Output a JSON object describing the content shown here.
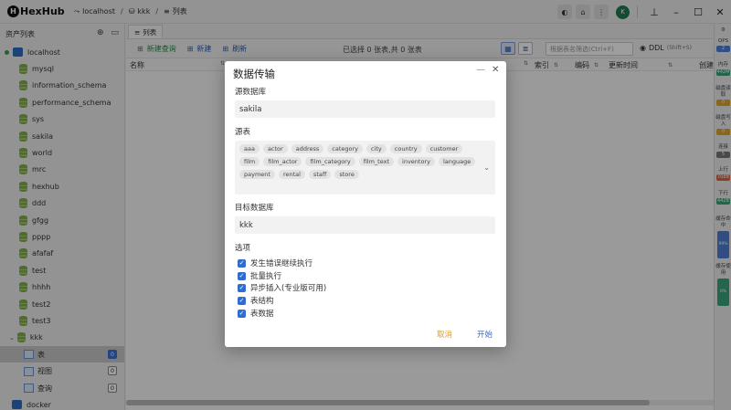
{
  "titlebar": {
    "app_name": "HexHub",
    "breadcrumbs": [
      {
        "icon": "connection-icon",
        "label": "localhost"
      },
      {
        "icon": "database-icon",
        "label": "kkk"
      },
      {
        "icon": "list-icon",
        "label": "列表"
      }
    ],
    "avatar_letter": "K"
  },
  "sidebar": {
    "title": "资产列表",
    "connection": "localhost",
    "databases": [
      "mysql",
      "information_schema",
      "performance_schema",
      "sys",
      "sakila",
      "world",
      "mrc",
      "hexhub",
      "ddd",
      "gfgg",
      "pppp",
      "afafaf",
      "test",
      "hhhh",
      "test2",
      "test3"
    ],
    "open_db": "kkk",
    "sub_items": [
      {
        "label": "表",
        "count": "0"
      },
      {
        "label": "视图",
        "count": "0"
      },
      {
        "label": "查询",
        "count": "0"
      }
    ],
    "docker": "docker"
  },
  "main": {
    "tab": "列表",
    "toolbar": {
      "new_query": "新建查询",
      "new": "新建",
      "refresh": "刷新",
      "selection_info": "已选择 0 张表,共 0 张表",
      "filter_placeholder": "根据表名筛选(Ctrl+F)",
      "ddl": "DDL",
      "ddl_shortcut": "(Shift+S)"
    },
    "columns": {
      "name": "名称",
      "index": "索引",
      "encoding": "编码",
      "updated": "更新时间",
      "created": "创建"
    }
  },
  "rail": {
    "qps_label": "QPS",
    "qps_value": "2",
    "memory_label": "内存",
    "memory_value": "442M",
    "disk_read_label": "磁盘读取",
    "disk_read_value": "0",
    "disk_write_label": "磁盘写入",
    "disk_write_value": "0",
    "conn_label": "连接",
    "conn_value": "5",
    "up_label": "上行",
    "up_value": "708B",
    "down_label": "下行",
    "down_value": "442B",
    "cache_hit_label": "缓存命中",
    "cache_hit_value": "99%",
    "cache_use_label": "缓存使用",
    "cache_use_value": "0%"
  },
  "dialog": {
    "title": "数据传输",
    "source_db_label": "源数据库",
    "source_db_value": "sakila",
    "source_tables_label": "源表",
    "source_tables": [
      "aaa",
      "actor",
      "address",
      "category",
      "city",
      "country",
      "customer",
      "film",
      "film_actor",
      "film_category",
      "film_text",
      "inventory",
      "language",
      "payment",
      "rental",
      "staff",
      "store"
    ],
    "target_db_label": "目标数据库",
    "target_db_value": "kkk",
    "options_label": "选项",
    "options": [
      "发生错误继续执行",
      "批量执行",
      "异步插入(专业版可用)",
      "表结构",
      "表数据"
    ],
    "cancel": "取消",
    "start": "开始"
  }
}
